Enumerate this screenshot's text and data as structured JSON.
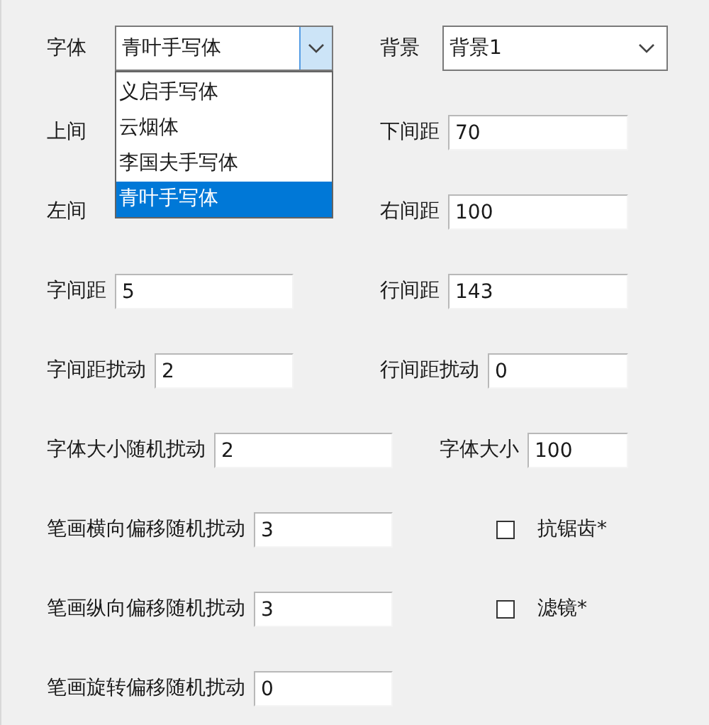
{
  "font_select": {
    "label": "字体",
    "value": "青叶手写体",
    "expanded": true,
    "options": [
      {
        "label": "义启手写体",
        "selected": false
      },
      {
        "label": "云烟体",
        "selected": false
      },
      {
        "label": "李国夫手写体",
        "selected": false
      },
      {
        "label": "青叶手写体",
        "selected": true
      }
    ]
  },
  "background_select": {
    "label": "背景",
    "value": "背景1"
  },
  "rows": [
    {
      "left": {
        "kind": "label",
        "label": "上间"
      },
      "right": {
        "kind": "field",
        "label": "下间距",
        "value": "70"
      }
    },
    {
      "left": {
        "kind": "label",
        "label": "左间"
      },
      "right": {
        "kind": "field",
        "label": "右间距",
        "value": "100"
      }
    },
    {
      "left": {
        "kind": "field",
        "label": "字间距",
        "value": "5"
      },
      "right": {
        "kind": "field",
        "label": "行间距",
        "value": "143"
      }
    },
    {
      "left": {
        "kind": "field",
        "label": "字间距扰动",
        "value": "2"
      },
      "right": {
        "kind": "field",
        "label": "行间距扰动",
        "value": "0"
      }
    },
    {
      "left": {
        "kind": "field",
        "label": "字体大小随机扰动",
        "value": "2"
      },
      "right": {
        "kind": "field",
        "label": "字体大小",
        "value": "100"
      }
    },
    {
      "left": {
        "kind": "field",
        "label": "笔画横向偏移随机扰动",
        "value": "3"
      },
      "right": {
        "kind": "checkbox",
        "label": "抗锯齿*",
        "checked": false
      }
    },
    {
      "left": {
        "kind": "field",
        "label": "笔画纵向偏移随机扰动",
        "value": "3"
      },
      "right": {
        "kind": "checkbox",
        "label": "滤镜*",
        "checked": false
      }
    },
    {
      "left": {
        "kind": "field",
        "label": "笔画旋转偏移随机扰动",
        "value": "0"
      }
    }
  ]
}
